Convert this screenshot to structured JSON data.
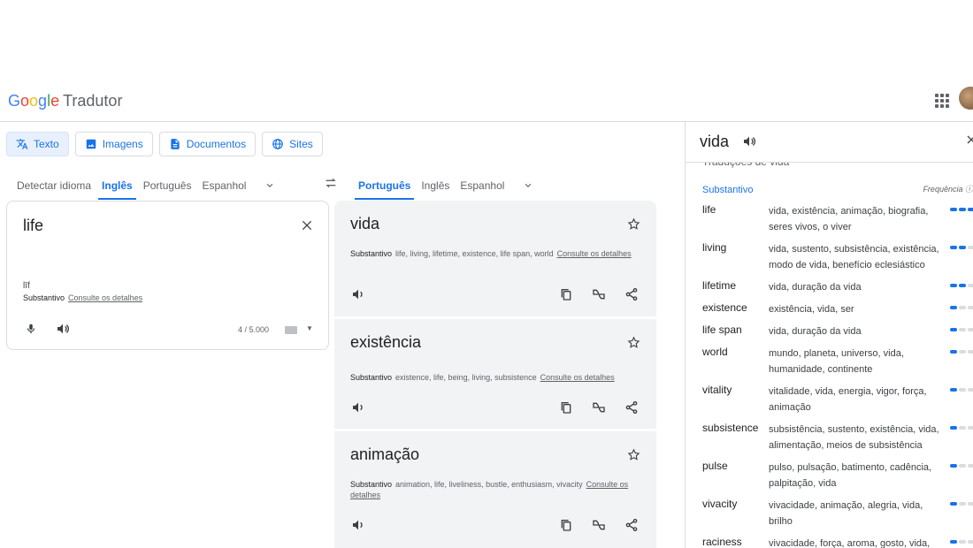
{
  "app": {
    "logo_letters": [
      "G",
      "o",
      "o",
      "g",
      "l",
      "e"
    ],
    "product": "Tradutor"
  },
  "modes": [
    {
      "label": "Texto",
      "icon": "translate-icon"
    },
    {
      "label": "Imagens",
      "icon": "image-icon"
    },
    {
      "label": "Documentos",
      "icon": "document-icon"
    },
    {
      "label": "Sites",
      "icon": "globe-icon"
    }
  ],
  "source_langs": [
    "Detectar idioma",
    "Inglês",
    "Português",
    "Espanhol"
  ],
  "target_langs": [
    "Português",
    "Inglês",
    "Espanhol"
  ],
  "source": {
    "text": "life",
    "transliteration": "līf",
    "pos": "Substantivo",
    "details_link": "Consulte os detalhes",
    "counter": "4 / 5.000"
  },
  "results": [
    {
      "word": "vida",
      "pos": "Substantivo",
      "back": "life, living, lifetime, existence, life span, world",
      "link": "Consulte os detalhes"
    },
    {
      "word": "existência",
      "pos": "Substantivo",
      "back": "existence, life, being, living, subsistence",
      "link": "Consulte os detalhes"
    },
    {
      "word": "animação",
      "pos": "Substantivo",
      "back": "animation, life, liveliness, bustle, enthusiasm, vivacity",
      "link": "Consulte os detalhes"
    }
  ],
  "panel": {
    "word": "vida",
    "peek": "Traduções de vida",
    "pos": "Substantivo",
    "frequency_label": "Frequência",
    "rows": [
      {
        "word": "life",
        "trans": "vida, existência, animação, biografia, seres vivos, o viver",
        "freq": 3
      },
      {
        "word": "living",
        "trans": "vida, sustento, subsistência, existência, modo de vida, benefício eclesiástico",
        "freq": 2
      },
      {
        "word": "lifetime",
        "trans": "vida, duração da vida",
        "freq": 2
      },
      {
        "word": "existence",
        "trans": "existência, vida, ser",
        "freq": 1
      },
      {
        "word": "life span",
        "trans": "vida, duração da vida",
        "freq": 1
      },
      {
        "word": "world",
        "trans": "mundo, planeta, universo, vida, humanidade, continente",
        "freq": 1
      },
      {
        "word": "vitality",
        "trans": "vitalidade, vida, energia, vigor, força, animação",
        "freq": 1
      },
      {
        "word": "subsistence",
        "trans": "subsistência, sustento, existência, vida, alimentação, meios de subsistência",
        "freq": 1
      },
      {
        "word": "pulse",
        "trans": "pulso, pulsação, batimento, cadência, palpitação, vida",
        "freq": 1
      },
      {
        "word": "vivacity",
        "trans": "vivacidade, animação, alegria, vida, brilho",
        "freq": 1
      },
      {
        "word": "raciness",
        "trans": "vivacidade, força, aroma, gosto, vida,",
        "freq": 1
      }
    ]
  },
  "colors": {
    "accent": "#1a73e8",
    "card_bg": "#f1f3f4",
    "border": "#dadce0"
  }
}
